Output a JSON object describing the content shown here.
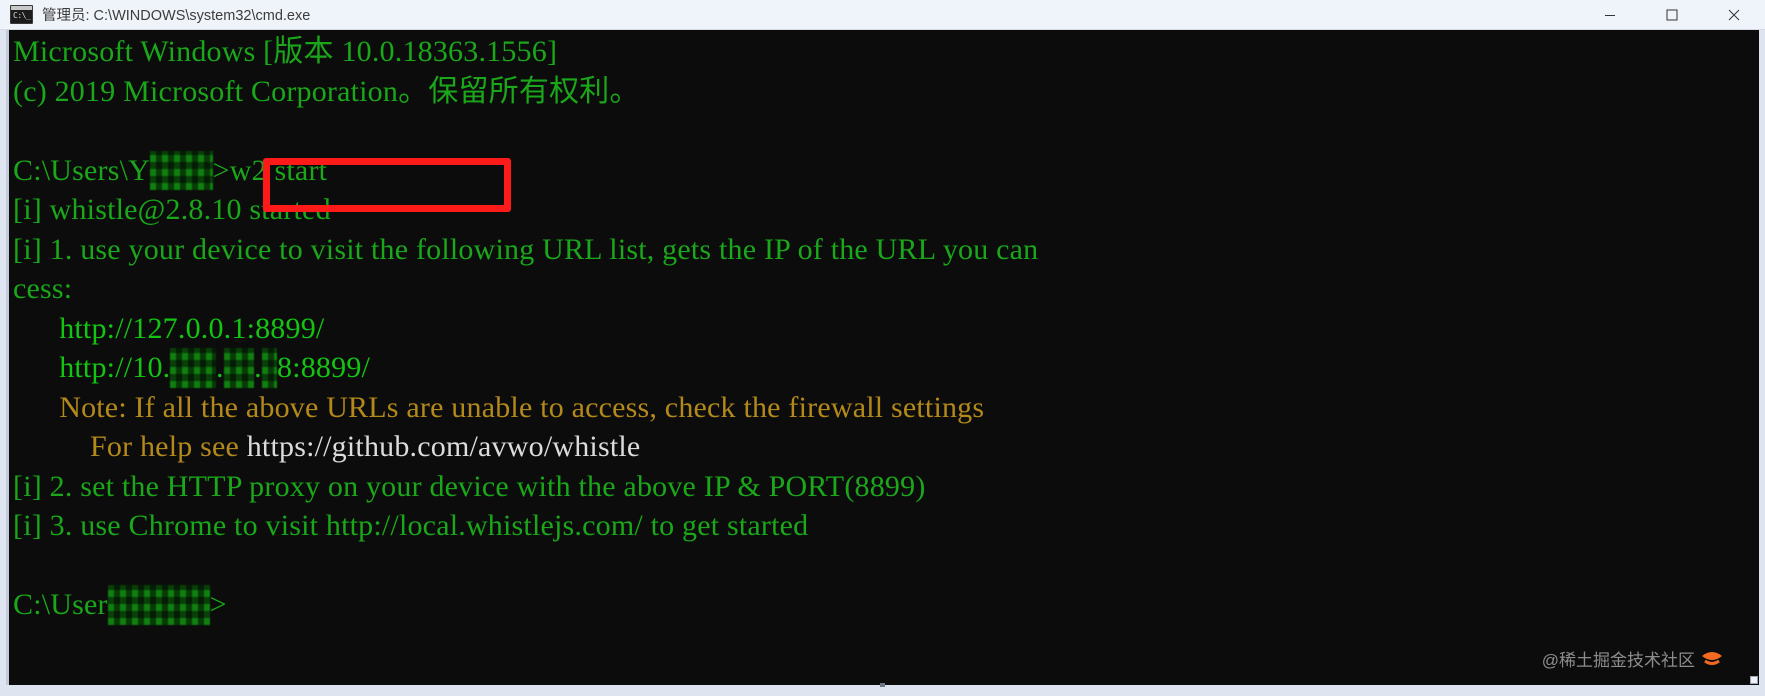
{
  "window": {
    "title": "管理员: C:\\WINDOWS\\system32\\cmd.exe",
    "icon_name": "cmd-icon",
    "icon_glyph": "C:\\_",
    "controls": {
      "minimize_label": "最小化",
      "maximize_label": "最大化",
      "close_label": "关闭"
    }
  },
  "console": {
    "background_color": "#0c0c0c",
    "text_color": "#16c60c",
    "lines": [
      {
        "segments": [
          {
            "text": "Microsoft Windows [版本 10.0.18363.1556]",
            "color": "green"
          }
        ]
      },
      {
        "segments": [
          {
            "text": "(c) 2019 Microsoft Corporation。保留所有权利。",
            "color": "green"
          }
        ]
      },
      {
        "segments": [
          {
            "text": "",
            "color": "green"
          }
        ]
      },
      {
        "segments": [
          {
            "text": "C:\\Users\\Y",
            "color": "green"
          },
          {
            "text": "elwri",
            "color": "green",
            "redacted": true
          },
          {
            "text": ">w2 start",
            "color": "green"
          }
        ]
      },
      {
        "segments": [
          {
            "text": "[i] whistle@2.8.10 started",
            "color": "green"
          }
        ]
      },
      {
        "segments": [
          {
            "text": "[i] 1. use your device to visit the following URL list, gets the IP of the URL you can",
            "color": "green"
          }
        ]
      },
      {
        "segments": [
          {
            "text": "cess:",
            "color": "green"
          }
        ]
      },
      {
        "segments": [
          {
            "text": "      http://127.0.0.1:8899/",
            "color": "brgreen"
          }
        ]
      },
      {
        "segments": [
          {
            "text": "      http://10.",
            "color": "brgreen"
          },
          {
            "text": "150",
            "color": "brgreen",
            "redacted": true
          },
          {
            "text": ".",
            "color": "brgreen"
          },
          {
            "text": "91",
            "color": "brgreen",
            "redacted": true
          },
          {
            "text": ".",
            "color": "brgreen"
          },
          {
            "text": "6",
            "color": "brgreen",
            "redacted": true
          },
          {
            "text": "8:8899/",
            "color": "brgreen"
          }
        ]
      },
      {
        "segments": [
          {
            "text": "      Note: If all the above URLs are unable to access, check the firewall settings",
            "color": "yellow"
          }
        ]
      },
      {
        "segments": [
          {
            "text": "          For help see ",
            "color": "yellow"
          },
          {
            "text": "https://github.com/avwo/whistle",
            "color": "white"
          }
        ]
      },
      {
        "segments": [
          {
            "text": "[i] 2. set the HTTP proxy on your device with the above IP & PORT(8899)",
            "color": "green"
          }
        ]
      },
      {
        "segments": [
          {
            "text": "[i] 3. use Chrome to visit http://local.whistlejs.com/ to get started",
            "color": "green"
          }
        ]
      },
      {
        "segments": [
          {
            "text": "",
            "color": "green"
          }
        ]
      },
      {
        "segments": [
          {
            "text": "C:\\User",
            "color": "green"
          },
          {
            "text": "s\\Yelwri",
            "color": "green",
            "redacted": true
          },
          {
            "text": ">",
            "color": "green"
          }
        ]
      }
    ]
  },
  "annotation": {
    "type": "red-rectangle",
    "color": "#ff1a1a",
    "highlights_text": "w2 start"
  },
  "watermark": {
    "text": "@稀土掘金技术社区",
    "logo_color": "#f56a21",
    "logo_name": "juejin-logo"
  }
}
